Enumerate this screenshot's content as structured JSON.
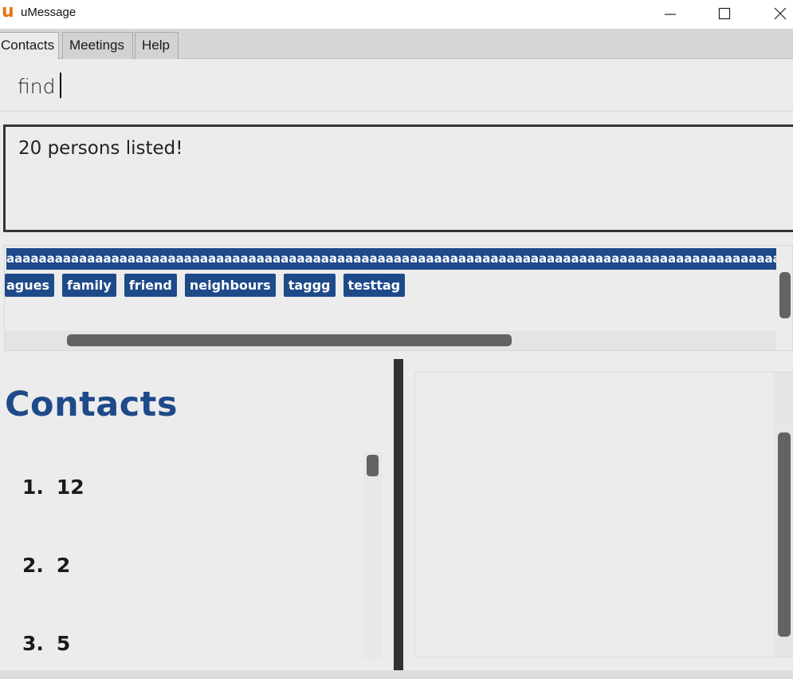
{
  "window": {
    "title": "uMessage",
    "logo_letter": "u",
    "accent": "#e8730e",
    "controls": [
      "minimize-icon",
      "maximize-icon",
      "close-icon"
    ]
  },
  "tabs": [
    {
      "label": "Contacts",
      "active": true
    },
    {
      "label": "Meetings",
      "active": false
    },
    {
      "label": "Help",
      "active": false
    }
  ],
  "command": {
    "value": "find"
  },
  "result": {
    "text": "20 persons listed!"
  },
  "tags": {
    "long_tag": "aaaaaaaaaaaaaaaaaaaaaaaaaaaaaaaaaaaaaaaaaaaaaaaaaaaaaaaaaaaaaaaaaaaaaaaaaaaaaaaaaaaaaaaaaaaaaaaaaaaaaaaaaaaaa",
    "items": [
      "agues",
      "family",
      "friend",
      "neighbours",
      "taggg",
      "testtag"
    ],
    "color": "#1e4a8a"
  },
  "contacts": {
    "heading": "Contacts",
    "heading_color": "#1e4a8a",
    "items": [
      {
        "index": "1.",
        "name": "12"
      },
      {
        "index": "2.",
        "name": "2"
      },
      {
        "index": "3.",
        "name": "5"
      }
    ]
  }
}
